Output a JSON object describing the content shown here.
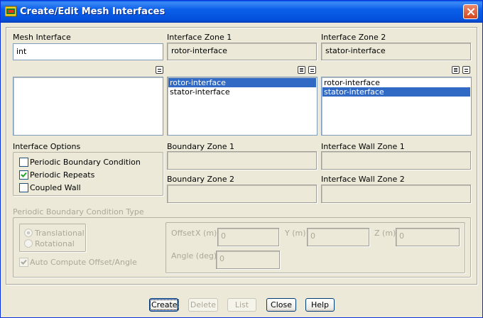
{
  "window": {
    "title": "Create/Edit Mesh Interfaces"
  },
  "mesh_interface": {
    "label": "Mesh Interface",
    "value": "int"
  },
  "interface_zone_1": {
    "label": "Interface Zone 1",
    "value": "rotor-interface",
    "list": [
      {
        "label": "rotor-interface",
        "selected": true
      },
      {
        "label": "stator-interface",
        "selected": false
      }
    ]
  },
  "interface_zone_2": {
    "label": "Interface Zone 2",
    "value": "stator-interface",
    "list": [
      {
        "label": "rotor-interface",
        "selected": false
      },
      {
        "label": "stator-interface",
        "selected": true
      }
    ]
  },
  "interface_options": {
    "label": "Interface Options",
    "options": [
      {
        "label": "Periodic Boundary Condition",
        "checked": false
      },
      {
        "label": "Periodic Repeats",
        "checked": true
      },
      {
        "label": "Coupled Wall",
        "checked": false
      }
    ]
  },
  "boundary_zone_1": {
    "label": "Boundary Zone 1",
    "value": ""
  },
  "boundary_zone_2": {
    "label": "Boundary Zone 2",
    "value": ""
  },
  "interface_wall_zone_1": {
    "label": "Interface Wall Zone 1",
    "value": ""
  },
  "interface_wall_zone_2": {
    "label": "Interface Wall Zone 2",
    "value": ""
  },
  "periodic_bc": {
    "label": "Periodic Boundary Condition Type",
    "translational": "Translational",
    "rotational": "Rotational",
    "auto_compute": "Auto Compute Offset/Angle",
    "offset_label": "Offset",
    "x_label": "X (m)",
    "y_label": "Y (m)",
    "z_label": "Z (m)",
    "x_value": "0",
    "y_value": "0",
    "z_value": "0",
    "angle_label": "Angle (deg)",
    "angle_value": "0"
  },
  "buttons": {
    "create": "Create",
    "delete": "Delete",
    "list": "List",
    "close": "Close",
    "help": "Help"
  }
}
